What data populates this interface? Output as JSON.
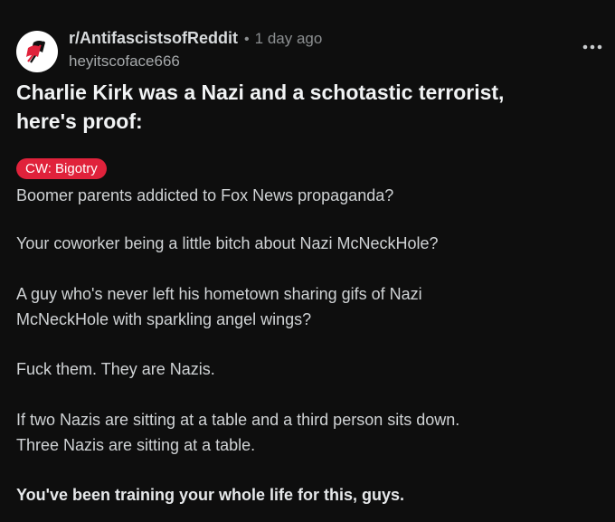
{
  "post": {
    "subreddit": "r/AntifascistsofReddit",
    "separator": "•",
    "time_ago": "1 day ago",
    "author": "heyitscoface666",
    "more_options_icon": "more-horizontal-icon",
    "title_line1": "Charlie Kirk was a Nazi and a schotastic terrorist,",
    "title_line2": "here's proof:",
    "flair": "CW: Bigotry",
    "paragraphs": {
      "p1": "Boomer parents addicted to Fox News propaganda?",
      "p2": "Your coworker being a little bitch about Nazi McNeckHole?",
      "p3_line1": "A guy who's never left his hometown sharing gifs of Nazi",
      "p3_line2": "McNeckHole with sparkling angel wings?",
      "p4": "Fuck them. They are Nazis.",
      "p5_line1": "If two Nazis are sitting at a table and a third person sits down.",
      "p5_line2": "Three Nazis are sitting at a table.",
      "p6": "You've been training your whole life for this, guys."
    }
  },
  "colors": {
    "background": "#0e0e0e",
    "flair_bg": "#e0223b",
    "avatar_bg": "#ffffff",
    "logo_red": "#e0223b",
    "logo_black": "#111111"
  }
}
